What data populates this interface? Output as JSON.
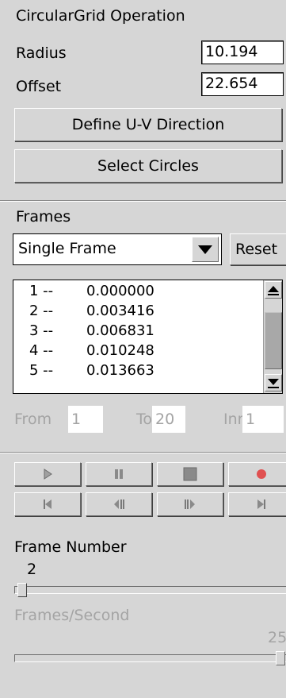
{
  "operation": {
    "title": "CircularGrid Operation",
    "radius_label": "Radius",
    "radius_value": "10.194",
    "offset_label": "Offset",
    "offset_value": "22.654",
    "define_uv_label": "Define U-V Direction",
    "select_circles_label": "Select Circles"
  },
  "frames": {
    "title": "Frames",
    "mode_selected": "Single Frame",
    "reset_label": "Reset",
    "list": [
      {
        "index": "1 --",
        "value": "0.000000"
      },
      {
        "index": "2 --",
        "value": "0.003416"
      },
      {
        "index": "3 --",
        "value": "0.006831"
      },
      {
        "index": "4 --",
        "value": "0.010248"
      },
      {
        "index": "5 --",
        "value": "0.013663"
      }
    ],
    "from_label": "From",
    "from_value": "1",
    "to_label": "To",
    "to_value": "20",
    "inr_label": "Inr",
    "inr_value": "1"
  },
  "playback": {
    "buttons": [
      "play-icon",
      "pause-icon",
      "stop-icon",
      "record-icon",
      "skip-to-start-icon",
      "step-back-icon",
      "step-forward-icon",
      "skip-to-end-icon"
    ],
    "record_color": "#e05050",
    "frame_number_label": "Frame Number",
    "frame_number_value": "2",
    "fps_label": "Frames/Second",
    "fps_value": "25"
  }
}
